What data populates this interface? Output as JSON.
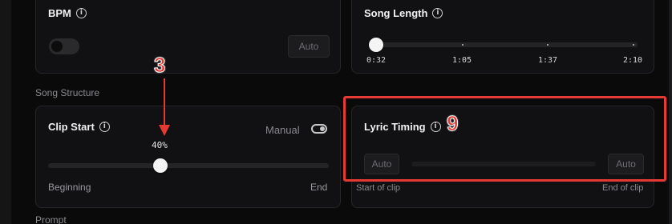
{
  "bpm": {
    "title": "BPM",
    "auto_label": "Auto",
    "toggle_on": false
  },
  "song_length": {
    "title": "Song Length",
    "ticks": [
      "0:32",
      "1:05",
      "1:37",
      "2:10"
    ],
    "value": "0:32"
  },
  "section": {
    "song_structure": "Song Structure",
    "prompt": "Prompt"
  },
  "clip_start": {
    "title": "Clip Start",
    "mode_label": "Manual",
    "value_label": "40%",
    "value_fraction": 0.4,
    "min_label": "Beginning",
    "max_label": "End"
  },
  "lyric_timing": {
    "title": "Lyric Timing",
    "start_button": "Auto",
    "end_button": "Auto",
    "start_label": "Start of clip",
    "end_label": "End of clip"
  },
  "annotations": {
    "marker_a": "3",
    "marker_b": "9",
    "color": "#e53935"
  }
}
